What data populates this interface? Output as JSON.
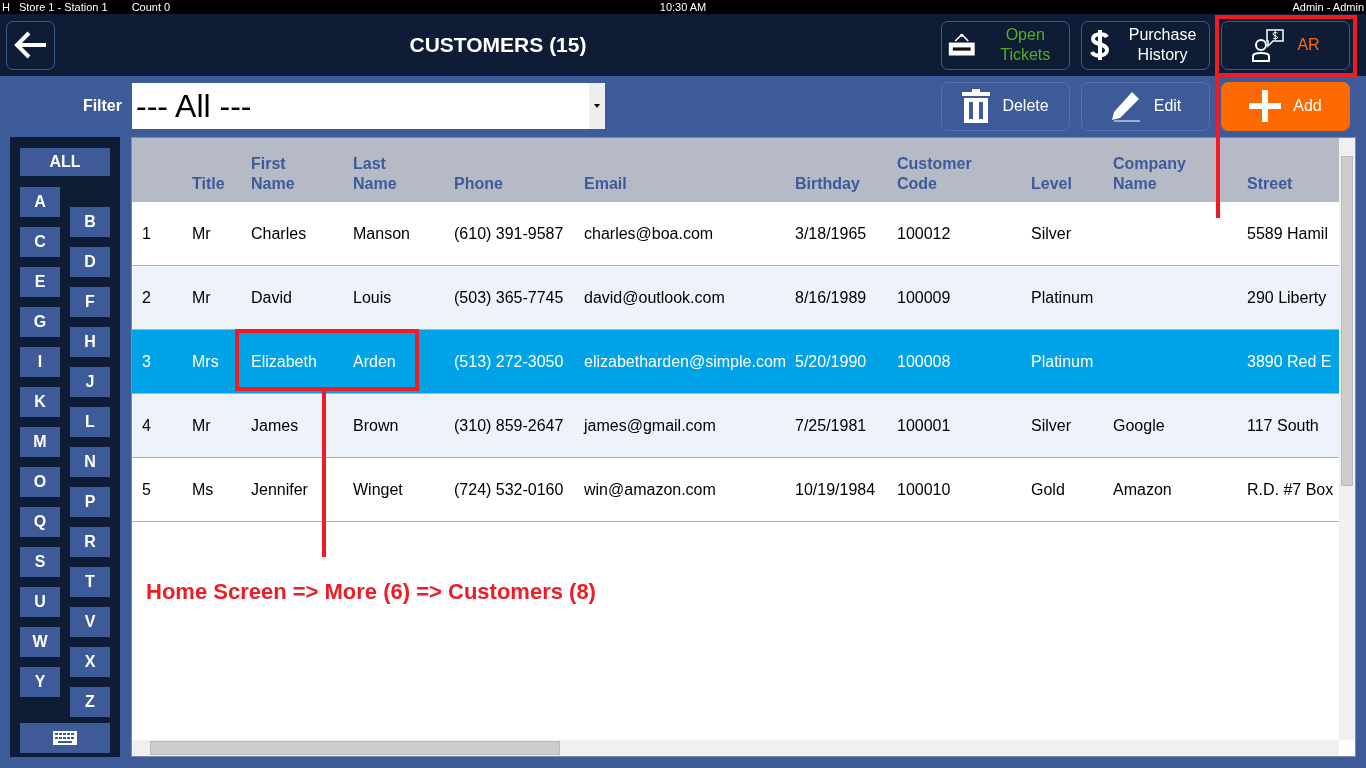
{
  "status_bar": {
    "mode": "H",
    "station": "Store 1 - Station 1",
    "count": "Count 0",
    "time": "10:30 AM",
    "user": "Admin - Admin"
  },
  "header": {
    "title": "CUSTOMERS (15)"
  },
  "top_buttons": [
    {
      "kind": "open",
      "label": "Open Tickets"
    },
    {
      "kind": "history",
      "label": "Purchase History"
    },
    {
      "kind": "ar",
      "label": "AR"
    }
  ],
  "filter": {
    "label": "Filter",
    "value": "--- All ---"
  },
  "action_buttons": [
    {
      "kind": "delete",
      "label": "Delete"
    },
    {
      "kind": "edit",
      "label": "Edit"
    },
    {
      "kind": "add",
      "label": "Add"
    }
  ],
  "alphabet": {
    "all": "ALL",
    "letters": [
      "A",
      "B",
      "C",
      "D",
      "E",
      "F",
      "G",
      "H",
      "I",
      "J",
      "K",
      "L",
      "M",
      "N",
      "O",
      "P",
      "Q",
      "R",
      "S",
      "T",
      "U",
      "V",
      "W",
      "X",
      "Y",
      "Z"
    ]
  },
  "table": {
    "columns": [
      "",
      "Title",
      "First Name",
      "Last Name",
      "Phone",
      "Email",
      "Birthday",
      "Customer Code",
      "Level",
      "Company Name",
      "Street"
    ],
    "rows": [
      {
        "selected": false,
        "cells": [
          "1",
          "Mr",
          "Charles",
          "Manson",
          "(610) 391-9587",
          "charles@boa.com",
          "3/18/1965",
          "100012",
          "Silver",
          "",
          "5589 Hamil"
        ]
      },
      {
        "selected": false,
        "cells": [
          "2",
          "Mr",
          "David",
          "Louis",
          "(503) 365-7745",
          "david@outlook.com",
          "8/16/1989",
          "100009",
          "Platinum",
          "",
          "290 Liberty"
        ]
      },
      {
        "selected": true,
        "cells": [
          "3",
          "Mrs",
          "Elizabeth",
          "Arden",
          "(513) 272-3050",
          "elizabetharden@simple.com",
          "5/20/1990",
          "100008",
          "Platinum",
          "",
          "3890 Red E"
        ]
      },
      {
        "selected": false,
        "cells": [
          "4",
          "Mr",
          "James",
          "Brown",
          "(310) 859-2647",
          "james@gmail.com",
          "7/25/1981",
          "100001",
          "Silver",
          "Google",
          "117 South"
        ]
      },
      {
        "selected": false,
        "cells": [
          "5",
          "Ms",
          "Jennifer",
          "Winget",
          "(724) 532-0160",
          "win@amazon.com",
          "10/19/1984",
          "100010",
          "Gold",
          "Amazon",
          "R.D. #7 Box"
        ]
      }
    ]
  },
  "annotation": {
    "caption": "Home Screen => More (6) => Customers (8)"
  }
}
